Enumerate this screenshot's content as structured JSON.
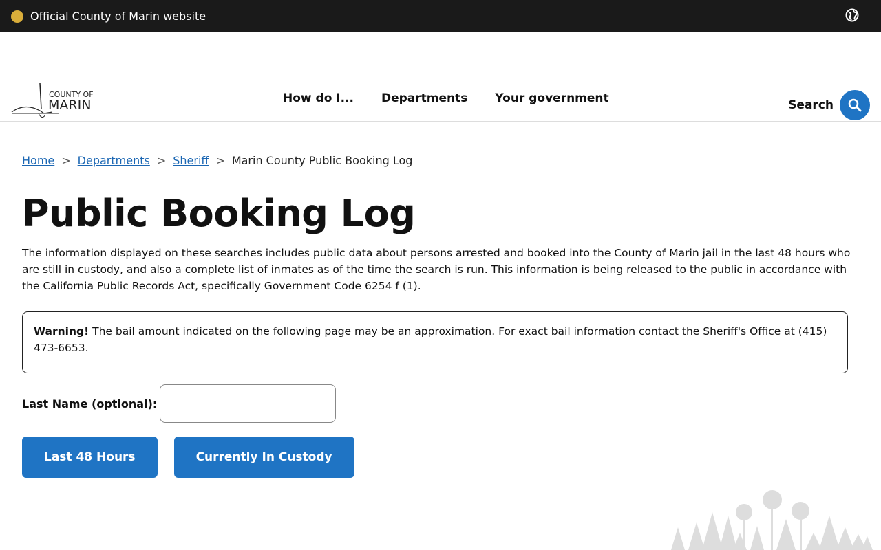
{
  "topbar": {
    "text": "Official County of Marin website",
    "icons": [
      "county-seal-icon",
      "globe-icon"
    ]
  },
  "header": {
    "logo": {
      "line1": "COUNTY OF",
      "line2": "MARIN"
    },
    "nav": [
      "How do I...",
      "Departments",
      "Your government"
    ],
    "search_label": "Search"
  },
  "breadcrumb": {
    "items": [
      "Home",
      "Departments",
      "Sheriff"
    ],
    "current": "Marin County Public Booking Log",
    "separator": ">"
  },
  "page": {
    "title": "Public Booking Log",
    "intro": "The information displayed on these searches includes public data about persons arrested and booked into the County of Marin jail in the last 48 hours who are still in custody, and also a complete list of inmates as of the time the search is run. This information is being released to the public in accordance with the California Public Records Act, specifically Government Code 6254 f (1).",
    "warning_label": "Warning!",
    "warning_text": " The bail amount indicated on the following page may be an approximation. For exact bail information contact the Sheriff's Office at (415) 473-6653."
  },
  "form": {
    "last_name_label": "Last Name (optional):",
    "last_name_value": "",
    "buttons": [
      "Last 48 Hours",
      "Currently In Custody"
    ]
  },
  "colors": {
    "accent": "#1f74c4",
    "topbar": "#1a1a1a"
  }
}
